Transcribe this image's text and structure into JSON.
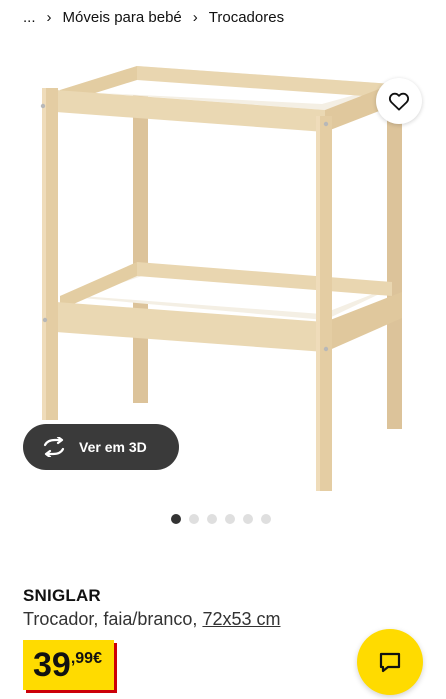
{
  "breadcrumb": {
    "ellipsis": "...",
    "items": [
      "Móveis para bebé",
      "Trocadores"
    ],
    "separator": "›"
  },
  "gallery": {
    "image_alt": "SNIGLAR Trocador, faia/branco",
    "favorite_icon": "heart-icon",
    "view_3d_label": "Ver em 3D",
    "view_3d_icon": "rotate-3d-icon",
    "slide_count": 6,
    "active_slide": 1
  },
  "product": {
    "name": "SNIGLAR",
    "description": "Trocador, faia/branco, ",
    "size": "72x53 cm",
    "price_integer": "39",
    "price_decimal": ",99€"
  },
  "chat": {
    "icon": "chat-icon"
  },
  "colors": {
    "accent_yellow": "#ffdb00",
    "price_shadow_red": "#cc0008",
    "pill_dark": "#3a3a3a"
  }
}
